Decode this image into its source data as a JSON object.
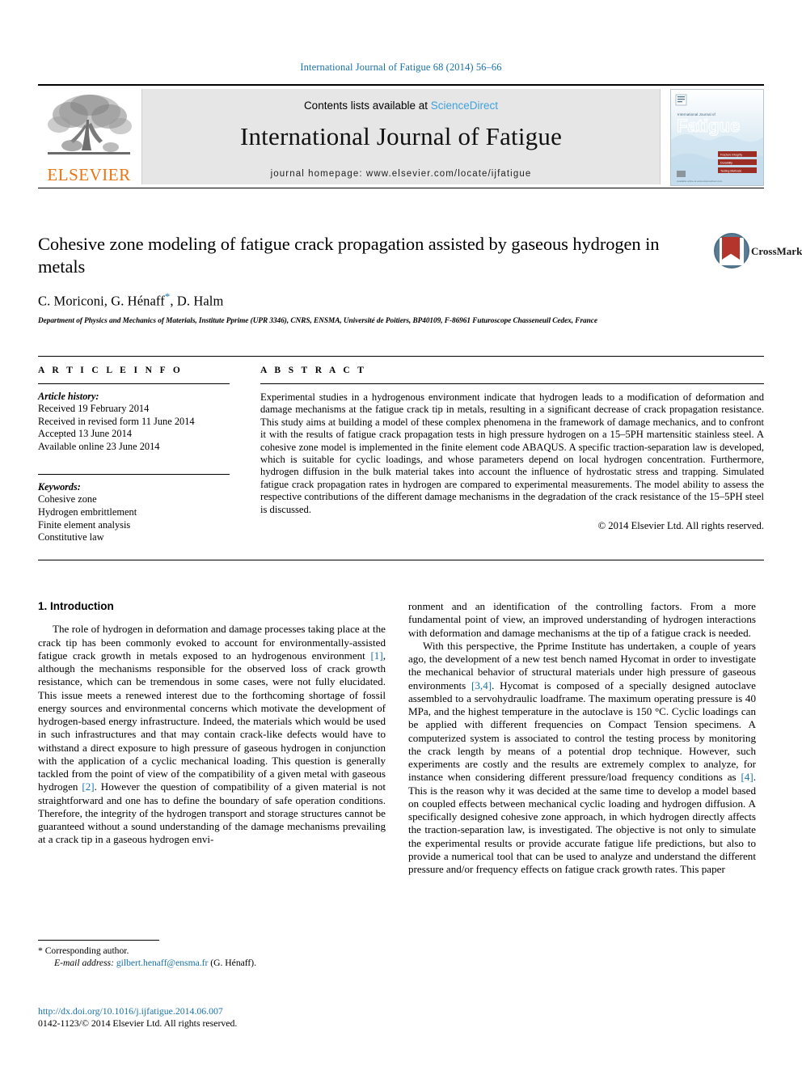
{
  "running_head": "International Journal of Fatigue 68 (2014) 56–66",
  "masthead": {
    "publisher_name": "ELSEVIER",
    "publisher_logo_icon": "elsevier-tree-icon",
    "contents_prefix": "Contents lists available at ",
    "sciencedirect_link": "ScienceDirect",
    "journal_title": "International Journal of Fatigue",
    "homepage": "journal homepage: www.elsevier.com/locate/ijfatigue",
    "cover": {
      "kicker": "International Journal of",
      "title": "Fatigue",
      "badges": [
        "Fracture Integrity",
        "Durability",
        "Testing Methods"
      ],
      "logo_icon": "elsevier-cover-logo-icon",
      "footer_text": "Available online at www.sciencedirect.com"
    }
  },
  "article": {
    "title": "Cohesive zone modeling of fatigue crack propagation assisted by gaseous hydrogen in metals",
    "authors": "C. Moriconi, G. Hénaff",
    "authors_tail": ", D. Halm",
    "corresponding_marker": "*",
    "affiliation": "Department of Physics and Mechanics of Materials, Institute Pprime (UPR 3346), CNRS, ENSMA, Université de Poitiers, BP40109, F-86961 Futuroscope Chasseneuil Cedex, France",
    "crossmark_label": "CrossMark",
    "crossmark_icon": "crossmark-bookmark-icon"
  },
  "article_info": {
    "section_label": "A R T I C L E    I N F O",
    "history_label": "Article history:",
    "history": [
      "Received 19 February 2014",
      "Received in revised form 11 June 2014",
      "Accepted 13 June 2014",
      "Available online 23 June 2014"
    ],
    "keywords_label": "Keywords:",
    "keywords": [
      "Cohesive zone",
      "Hydrogen embrittlement",
      "Finite element analysis",
      "Constitutive law"
    ]
  },
  "abstract": {
    "section_label": "A B S T R A C T",
    "text": "Experimental studies in a hydrogenous environment indicate that hydrogen leads to a modification of deformation and damage mechanisms at the fatigue crack tip in metals, resulting in a significant decrease of crack propagation resistance. This study aims at building a model of these complex phenomena in the framework of damage mechanics, and to confront it with the results of fatigue crack propagation tests in high pressure hydrogen on a 15–5PH martensitic stainless steel. A cohesive zone model is implemented in the finite element code ABAQUS. A specific traction-separation law is developed, which is suitable for cyclic loadings, and whose parameters depend on local hydrogen concentration. Furthermore, hydrogen diffusion in the bulk material takes into account the influence of hydrostatic stress and trapping. Simulated fatigue crack propagation rates in hydrogen are compared to experimental measurements. The model ability to assess the respective contributions of the different damage mechanisms in the degradation of the crack resistance of the 15–5PH steel is discussed.",
    "copyright": "© 2014 Elsevier Ltd. All rights reserved."
  },
  "body": {
    "section_heading": "1. Introduction",
    "left_p1_a": "The role of hydrogen in deformation and damage processes taking place at the crack tip has been commonly evoked to account for environmentally-assisted fatigue crack growth in metals exposed to an hydrogenous environment ",
    "left_ref1": "[1]",
    "left_p1_b": ", although the mechanisms responsible for the observed loss of crack growth resistance, which can be tremendous in some cases, were not fully elucidated. This issue meets a renewed interest due to the forthcoming shortage of fossil energy sources and environmental concerns which motivate the development of hydrogen-based energy infrastructure. Indeed, the materials which would be used in such infrastructures and that may contain crack-like defects would have to withstand a direct exposure to high pressure of gaseous hydrogen in conjunction with the application of a cyclic mechanical loading. This question is generally tackled from the point of view of the compatibility of a given metal with gaseous hydrogen ",
    "left_ref2": "[2]",
    "left_p1_c": ". However the question of compatibility of a given material is not straightforward and one has to define the boundary of safe operation conditions. Therefore, the integrity of the hydrogen transport and storage structures cannot be guaranteed without a sound understanding of the damage mechanisms prevailing at a crack tip in a gaseous hydrogen envi-",
    "right_p1_cont": "ronment and an identification of the controlling factors. From a more fundamental point of view, an improved understanding of hydrogen interactions with deformation and damage mechanisms at the tip of a fatigue crack is needed.",
    "right_p2_a": "With this perspective, the Pprime Institute has undertaken, a couple of years ago, the development of a new test bench named Hycomat in order to investigate the mechanical behavior of structural materials under high pressure of gaseous environments ",
    "right_ref34": "[3,4]",
    "right_p2_b": ". Hycomat is composed of a specially designed autoclave assembled to a servohydraulic loadframe. The maximum operating pressure is 40 MPa, and the highest temperature in the autoclave is 150 °C. Cyclic loadings can be applied with different frequencies on Compact Tension specimens. A computerized system is associated to control the testing process by monitoring the crack length by means of a potential drop technique. However, such experiments are costly and the results are extremely complex to analyze, for instance when considering different pressure/load frequency conditions as ",
    "right_ref4": "[4]",
    "right_p2_c": ". This is the reason why it was decided at the same time to develop a model based on coupled effects between mechanical cyclic loading and hydrogen diffusion. A specifically designed cohesive zone approach, in which hydrogen directly affects the traction-separation law, is investigated. The objective is not only to simulate the experimental results or provide accurate fatigue life predictions, but also to provide a numerical tool that can be used to analyze and understand the different pressure and/or frequency effects on fatigue crack growth rates. This paper"
  },
  "footnote": {
    "corresponding_marker": "*",
    "corresponding_text": "Corresponding author.",
    "email_label": "E-mail address:",
    "email": "gilbert.henaff@ensma.fr",
    "email_owner": "(G. Hénaff)."
  },
  "footer": {
    "doi": "http://dx.doi.org/10.1016/j.ijfatigue.2014.06.007",
    "issn_line": "0142-1123/© 2014 Elsevier Ltd. All rights reserved."
  },
  "colors": {
    "link_blue": "#1a72a8",
    "sciencedirect_blue": "#3da2dd",
    "elsevier_orange": "#e87511",
    "banner_gray": "#e6e6e6",
    "crossmark_red": "#b4352b"
  }
}
